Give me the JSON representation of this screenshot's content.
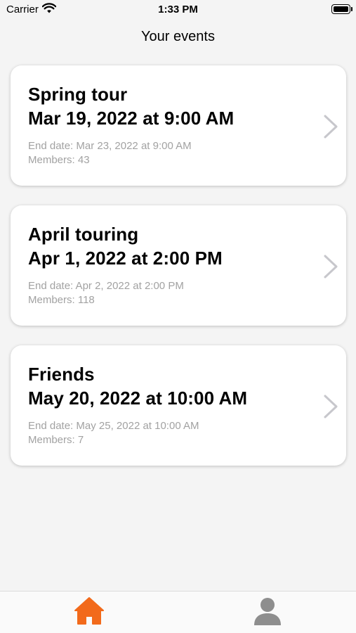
{
  "status_bar": {
    "carrier": "Carrier",
    "time": "1:33 PM"
  },
  "nav": {
    "title": "Your events"
  },
  "events": [
    {
      "name": "Spring tour",
      "start": "Mar 19, 2022 at 9:00 AM",
      "end": "End date: Mar 23, 2022 at 9:00 AM",
      "members": "Members: 43"
    },
    {
      "name": "April touring",
      "start": "Apr 1, 2022 at 2:00 PM",
      "end": "End date: Apr 2, 2022 at 2:00 PM",
      "members": "Members: 118"
    },
    {
      "name": "Friends",
      "start": "May 20, 2022 at 10:00 AM",
      "end": "End date: May 25, 2022 at 10:00 AM",
      "members": "Members: 7"
    }
  ],
  "tab_bar": {
    "items": [
      {
        "icon": "home-icon",
        "selected": true
      },
      {
        "icon": "profile-icon",
        "selected": false
      }
    ]
  },
  "colors": {
    "accent": "#f26a1b",
    "inactive": "#8e8e8e",
    "secondary_text": "#a2a2a2",
    "background": "#f4f4f4"
  }
}
